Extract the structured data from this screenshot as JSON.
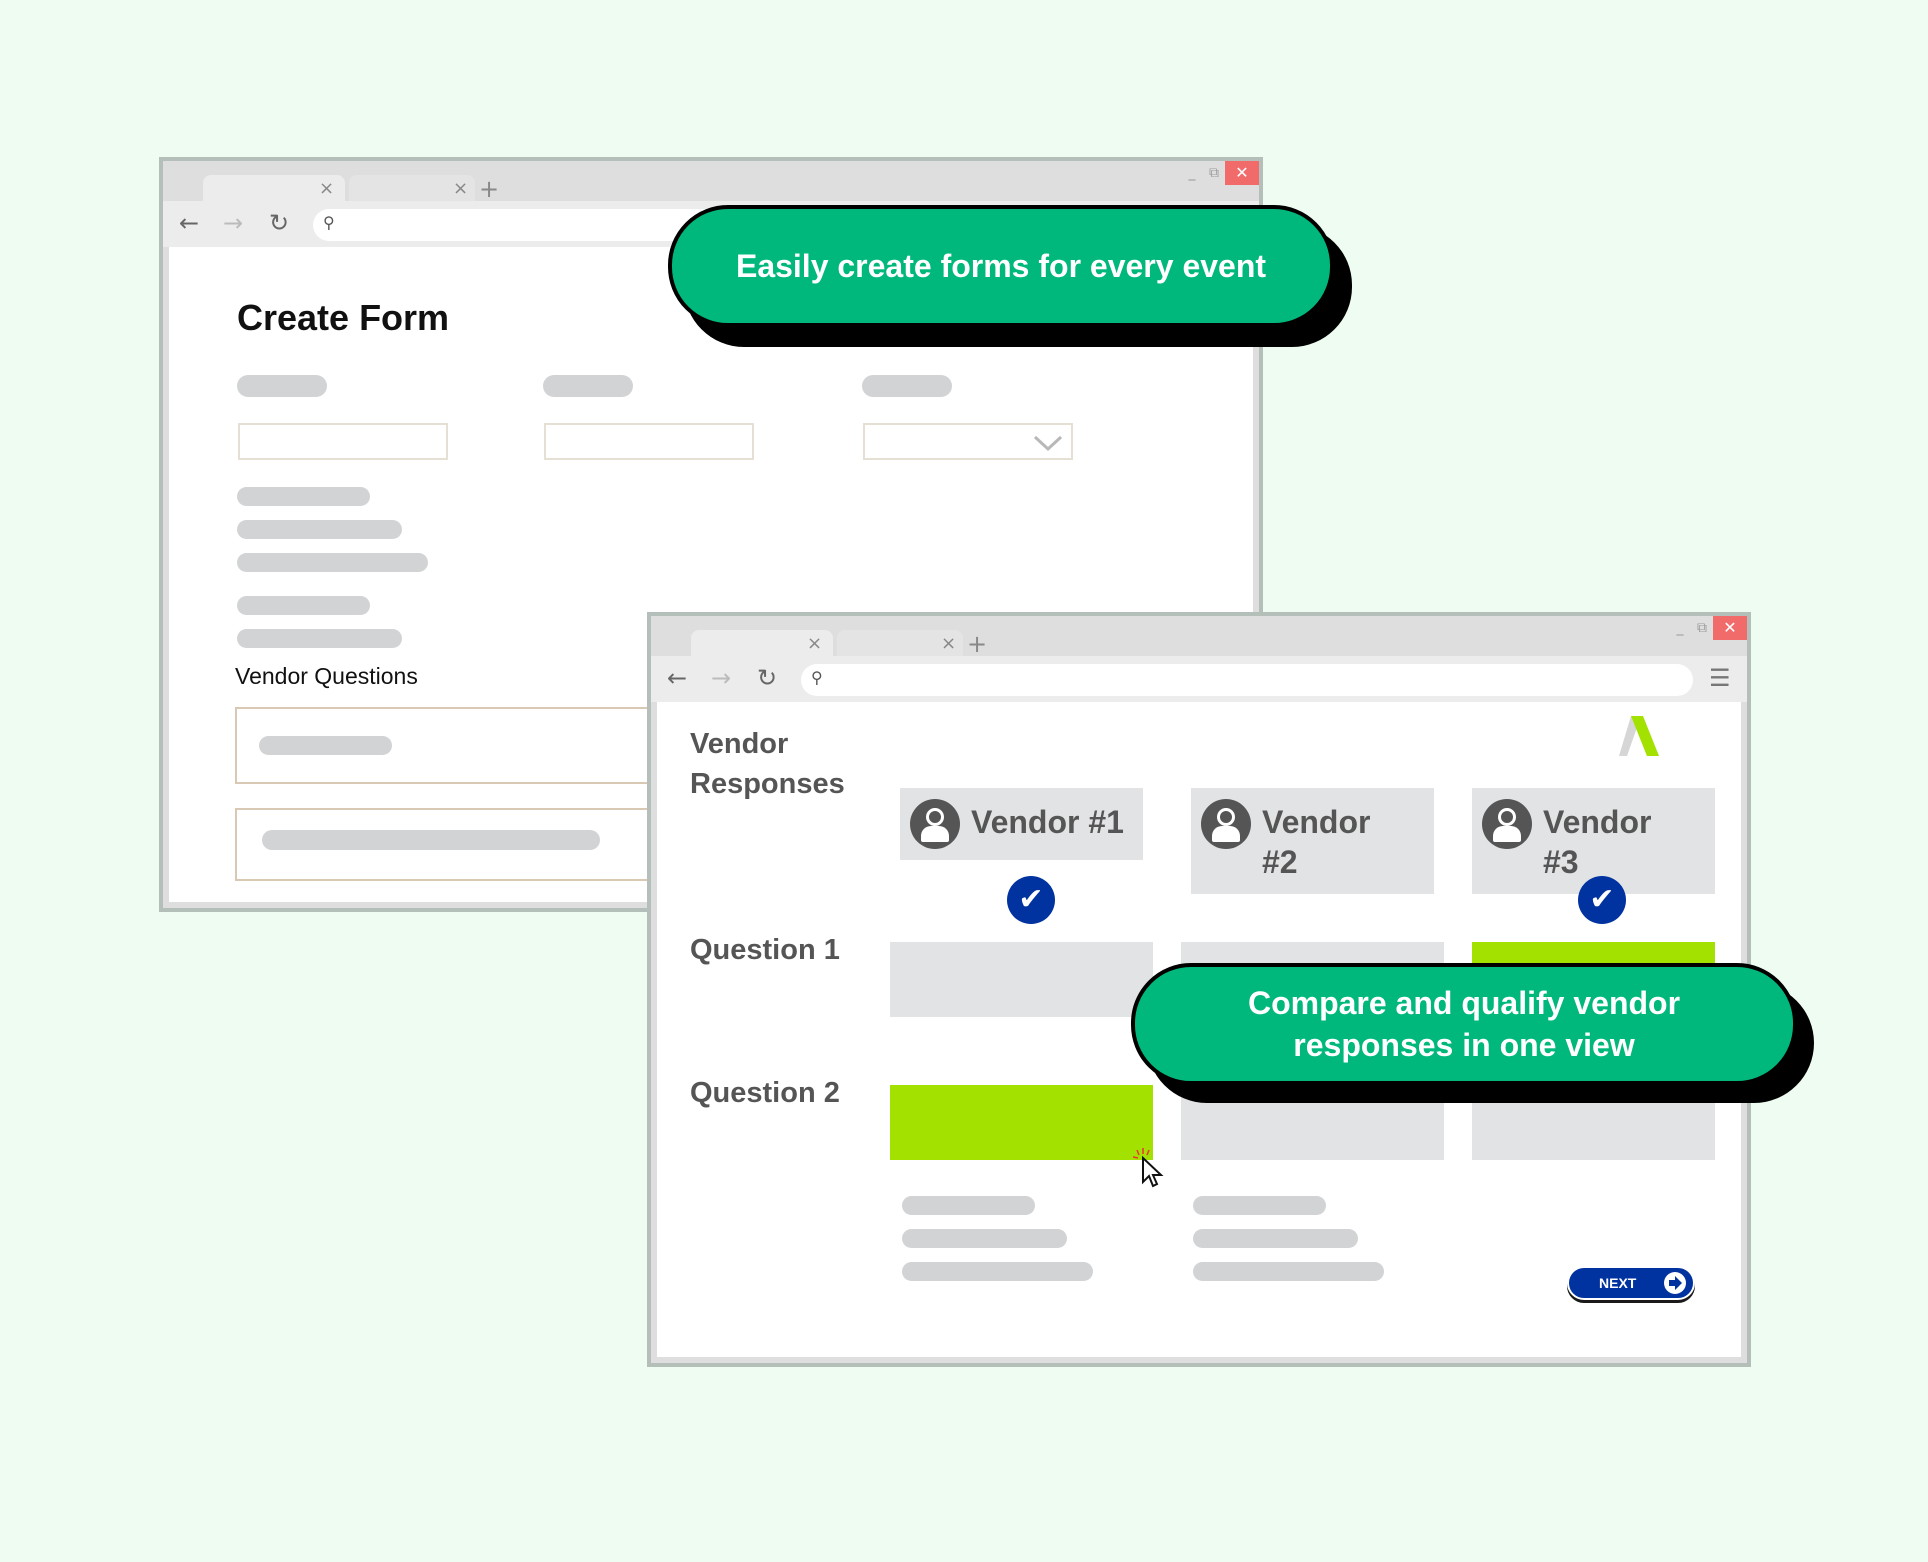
{
  "colors": {
    "background": "#eefcf1",
    "callout_green": "#00b87c",
    "highlight_lime": "#a3e100",
    "check_blue": "#0033a0",
    "close_red": "#f26b6b",
    "placeholder_gray": "#d2d3d5"
  },
  "create_form_window": {
    "tabs": [
      {
        "close_icon": "×"
      },
      {
        "close_icon": "×"
      }
    ],
    "new_tab_icon": "+",
    "window_controls": {
      "minimize": "_",
      "restore": "⧉",
      "close": "✕"
    },
    "nav": {
      "back": "←",
      "forward": "→",
      "reload": "↻",
      "search_icon": "⚲"
    },
    "title": "Create Form",
    "dropdown_icon": "chevron-down",
    "section_label": "Vendor Questions"
  },
  "vendor_window": {
    "tabs": [
      {
        "close_icon": "×"
      },
      {
        "close_icon": "×"
      }
    ],
    "new_tab_icon": "+",
    "window_controls": {
      "minimize": "_",
      "restore": "⧉",
      "close": "✕"
    },
    "nav": {
      "back": "←",
      "forward": "→",
      "reload": "↻",
      "search_icon": "⚲",
      "menu_icon": "☰"
    },
    "title_line1": "Vendor",
    "title_line2": "Responses",
    "vendors": [
      {
        "line1": "Vendor #1",
        "line2": "",
        "selected": true
      },
      {
        "line1": "Vendor",
        "line2": "#2",
        "selected": false
      },
      {
        "line1": "Vendor",
        "line2": "#3",
        "selected": true
      }
    ],
    "questions": [
      {
        "label": "Question 1",
        "highlighted_vendor": 3
      },
      {
        "label": "Question 2",
        "highlighted_vendor": 1
      }
    ],
    "check_icon": "✔",
    "next_button": {
      "label": "NEXT",
      "icon": "arrow-right-circle"
    }
  },
  "callouts": {
    "top": "Easily create forms for every event",
    "bottom_line1": "Compare and qualify vendor",
    "bottom_line2": "responses in one view"
  }
}
